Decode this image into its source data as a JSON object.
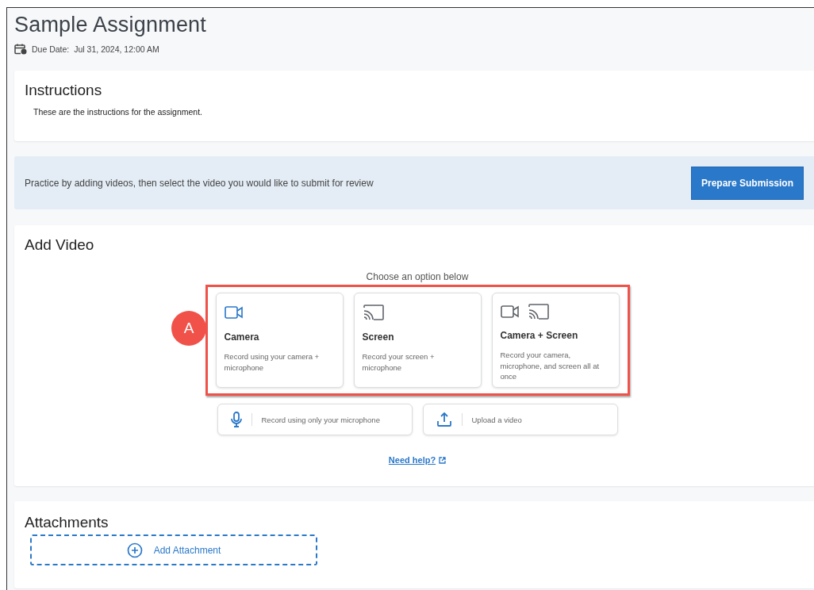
{
  "page": {
    "title": "Sample Assignment",
    "due_label": "Due Date:",
    "due_value": "Jul 31, 2024, 12:00 AM"
  },
  "instructions": {
    "heading": "Instructions",
    "text": "These are the instructions for the assignment."
  },
  "banner": {
    "text": "Practice by adding videos, then select the video you would like to submit for review",
    "button": "Prepare Submission"
  },
  "add_video": {
    "heading": "Add Video",
    "prompt": "Choose an option below",
    "annotation": {
      "label": "A"
    },
    "options": [
      {
        "kind": "camera",
        "title": "Camera",
        "description": "Record using your camera + microphone"
      },
      {
        "kind": "screen",
        "title": "Screen",
        "description": "Record your screen + microphone"
      },
      {
        "kind": "camera_screen",
        "title": "Camera + Screen",
        "description": "Record your camera, microphone, and screen all at once"
      }
    ],
    "actions": [
      {
        "kind": "microphone",
        "label": "Record using only your microphone"
      },
      {
        "kind": "upload",
        "label": "Upload a video"
      }
    ],
    "help_link": "Need help?"
  },
  "attachments": {
    "heading": "Attachments",
    "button": "Add Attachment"
  }
}
